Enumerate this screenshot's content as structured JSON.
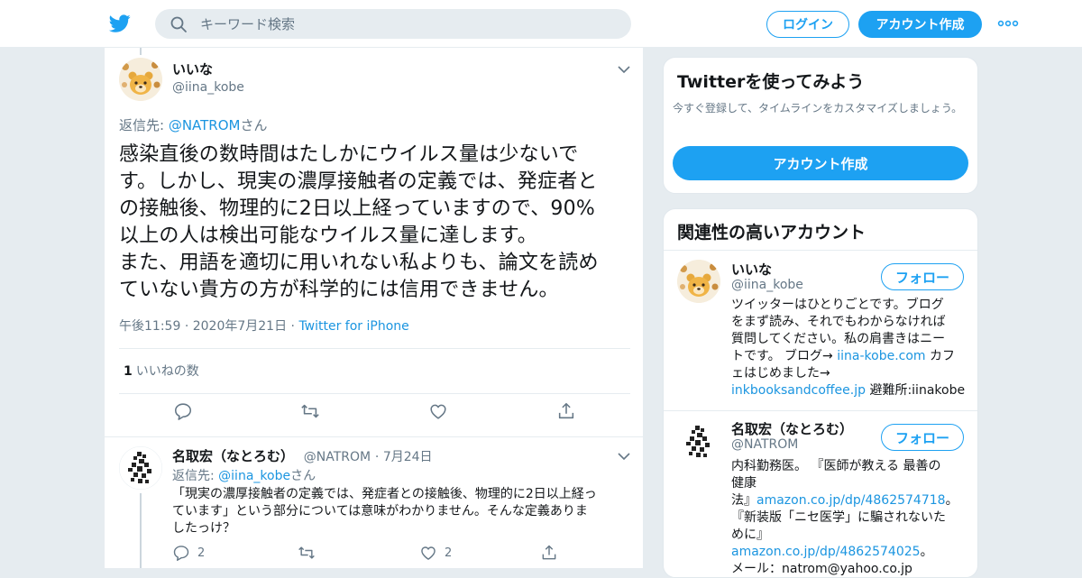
{
  "topbar": {
    "search_placeholder": "キーワード検索",
    "login_label": "ログイン",
    "signup_label": "アカウント作成",
    "brand_color": "#1da1f2"
  },
  "main_tweet": {
    "name": "いいな",
    "handle": "@iina_kobe",
    "reply_prefix": "返信先: ",
    "reply_to": "@NATROM",
    "reply_suffix": "さん",
    "text_lines": [
      "感染直後の数時間はたしかにウイルス量は少ないで",
      "す。しかし、現実の濃厚接触者の定義では、発症者と",
      "の接触後、物理的に2日以上経っていますので、90%",
      "以上の人は検出可能なウイルス量に達します。",
      "また、用語を適切に用いれない私よりも、論文を読め",
      "ていない貴方の方が科学的には信用できません。"
    ],
    "time": "午後11:59",
    "date": "2020年7月21日",
    "source": "Twitter for iPhone",
    "like_count": "1",
    "like_label": "いいねの数"
  },
  "reply_tweet": {
    "name": "名取宏（なとろむ）",
    "handle": "@NATROM",
    "date": "7月24日",
    "reply_prefix": "返信先: ",
    "reply_to": "@iina_kobe",
    "reply_suffix": "さん",
    "text_lines": [
      "「現実の濃厚接触者の定義では、発症者との接触後、物理的に2日以上経っ",
      "ています」という部分については意味がわかりません。そんな定義ありま",
      "したっけ？"
    ],
    "reply_count": "2",
    "like_count": "2"
  },
  "sidebar": {
    "try_card": {
      "title": "Twitterを使ってみよう",
      "subtitle": "今すぐ登録して、タイムラインをカスタマイズしましょう。",
      "button": "アカウント作成"
    },
    "related": {
      "title": "関連性の高いアカウント",
      "follow_label": "フォロー",
      "accounts": [
        {
          "name": "いいな",
          "handle": "@iina_kobe",
          "bio_lines": [
            {
              "text": "ツイッターはひとりごとです。ブログ"
            },
            {
              "text": "をまず読み、それでもわからなければ"
            },
            {
              "text": "質問してください。私の肩書きはニー"
            },
            {
              "pre": "トです。 ブログ→ ",
              "link": "iina-kobe.com",
              "post": " カフ"
            },
            {
              "text": "ェはじめました→"
            },
            {
              "pre": "",
              "link": "inkbooksandcoffee.jp",
              "post": " 避難所:iinakobe"
            }
          ]
        },
        {
          "name": "名取宏（なとろむ）",
          "handle": "@NATROM",
          "bio_lines": [
            {
              "text": "内科勤務医。 『医師が教える 最善の"
            },
            {
              "text": "健康"
            },
            {
              "pre": "法』",
              "link": "amazon.co.jp/dp/4862574718",
              "post": "。"
            },
            {
              "text": "『新装版「ニセ医学」に騙されないた"
            },
            {
              "pre": "めに』",
              "link": "amazon.co.jp/dp/4862574025",
              "post": "。"
            },
            {
              "text": "メール：natrom@yahoo.co.jp"
            }
          ]
        }
      ]
    }
  }
}
